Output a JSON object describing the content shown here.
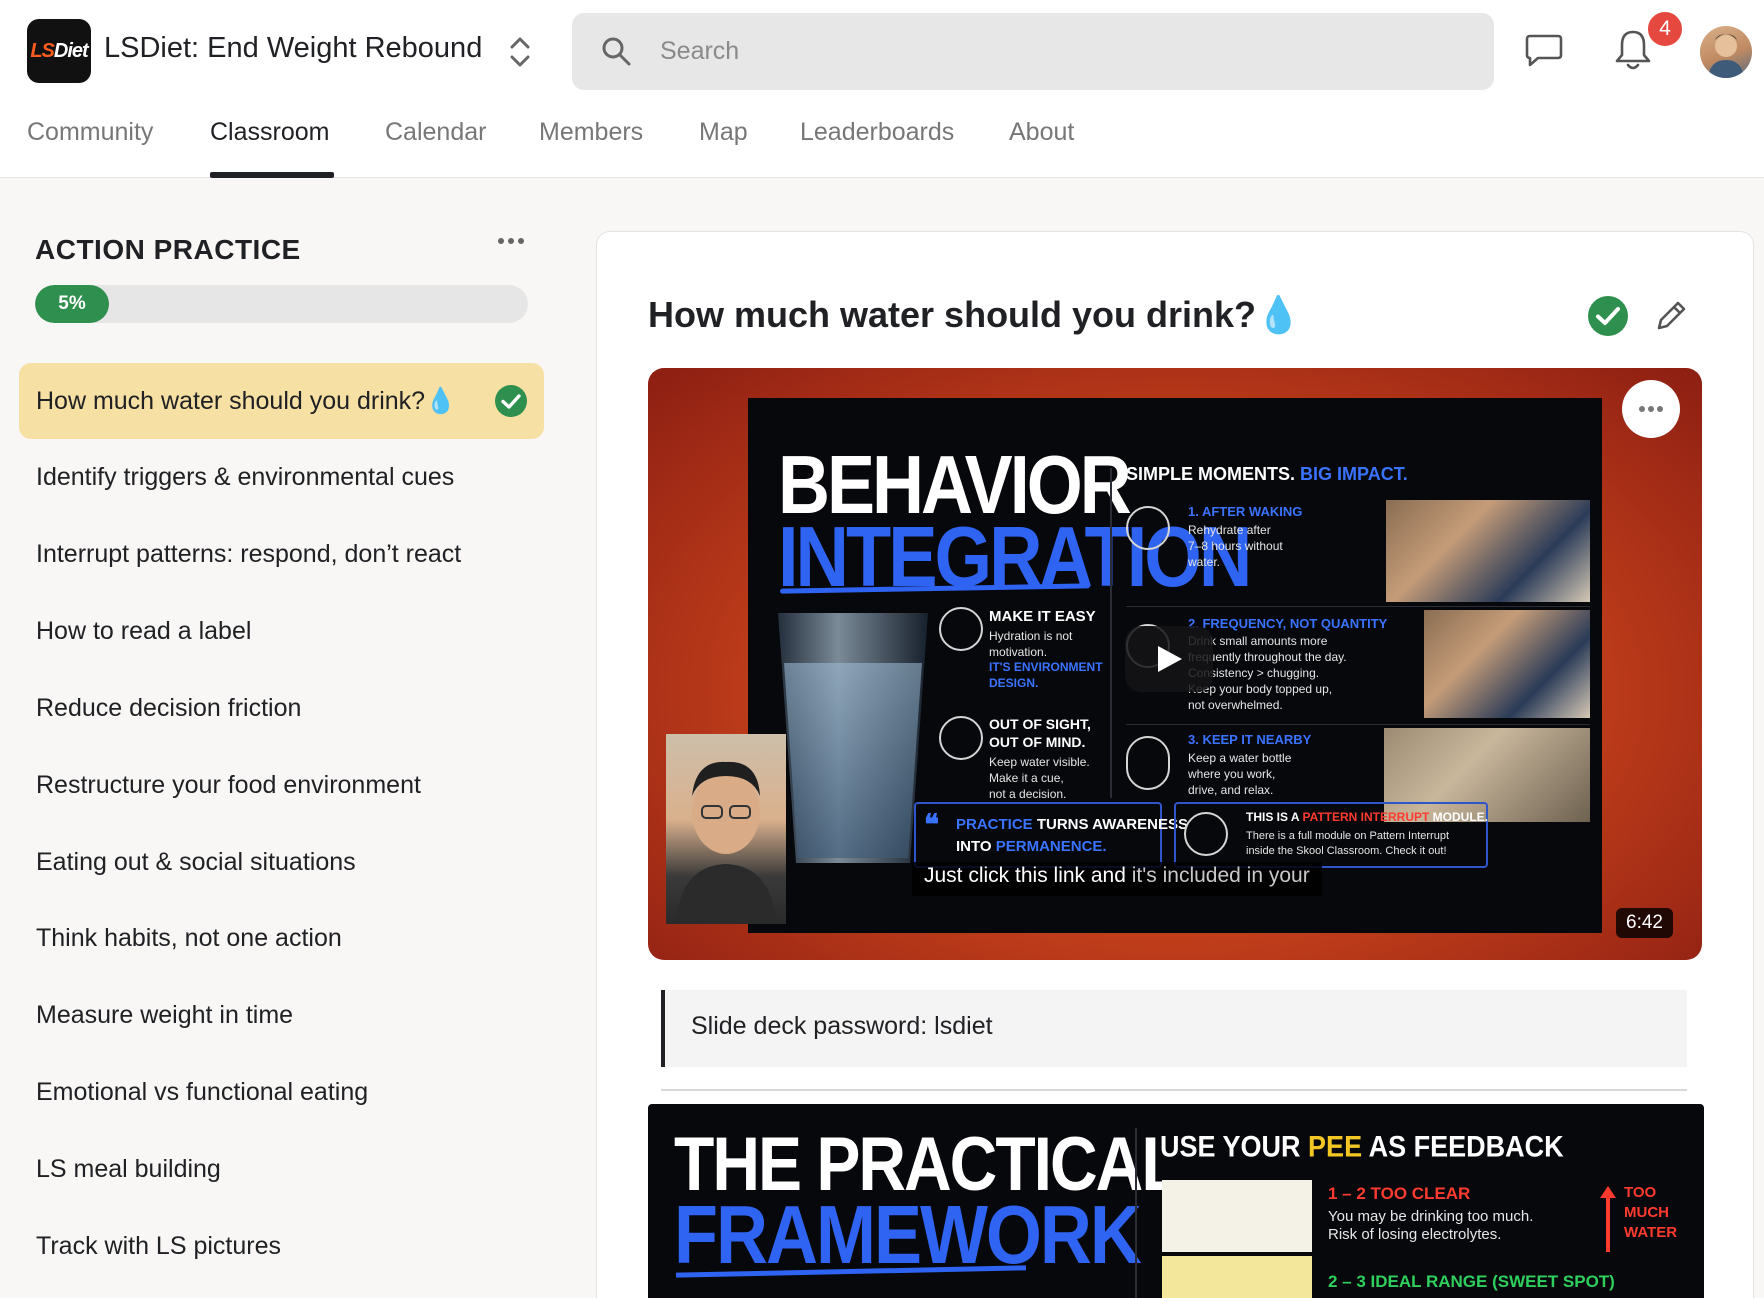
{
  "app": {
    "logo_text_ls": "LS",
    "logo_text_diet": "Diet",
    "title": "LSDiet: End Weight Rebound"
  },
  "search": {
    "placeholder": "Search"
  },
  "notifications": {
    "count": "4"
  },
  "tabs": [
    {
      "label": "Community",
      "active": false
    },
    {
      "label": "Classroom",
      "active": true
    },
    {
      "label": "Calendar",
      "active": false
    },
    {
      "label": "Members",
      "active": false
    },
    {
      "label": "Map",
      "active": false
    },
    {
      "label": "Leaderboards",
      "active": false
    },
    {
      "label": "About",
      "active": false
    }
  ],
  "sidebar": {
    "module_title": "ACTION PRACTICE",
    "progress_label": "5%",
    "progress_value": 5,
    "lessons": [
      {
        "label": "How much water should you drink?💧",
        "active": true,
        "completed": true
      },
      {
        "label": "Identify triggers & environmental cues"
      },
      {
        "label": "Interrupt patterns: respond, don’t react"
      },
      {
        "label": "How to read a label"
      },
      {
        "label": "Reduce decision friction"
      },
      {
        "label": "Restructure your food environment"
      },
      {
        "label": "Eating out & social situations"
      },
      {
        "label": "Think habits, not one action"
      },
      {
        "label": "Measure weight in time"
      },
      {
        "label": "Emotional vs functional eating"
      },
      {
        "label": "LS meal building"
      },
      {
        "label": "Track with LS pictures"
      }
    ]
  },
  "lesson": {
    "title": "How much water should you drink?💧",
    "video": {
      "slide": {
        "headline_1": "BEHAVIOR",
        "headline_2": "INTEGRATION",
        "simple_moments": "SIMPLE MOMENTS.",
        "big_impact": "BIG IMPACT.",
        "make_it_easy": "MAKE IT EASY",
        "make_it_easy_body_1": "Hydration is not",
        "make_it_easy_body_2": "motivation.",
        "make_it_easy_blue_1": "IT'S ENVIRONMENT",
        "make_it_easy_blue_2": "DESIGN.",
        "out_of_sight_1": "OUT OF SIGHT,",
        "out_of_sight_2": "OUT OF MIND.",
        "out_of_sight_body_1": "Keep water visible.",
        "out_of_sight_body_2": "Make it a cue,",
        "out_of_sight_body_3": "not a decision.",
        "item1_title": "1. AFTER WAKING",
        "item1_body_1": "Rehydrate after",
        "item1_body_2": "7–8 hours without",
        "item1_body_3": "water.",
        "item2_title": "2. FREQUENCY, NOT QUANTITY",
        "item2_body_1": "Drink small amounts more",
        "item2_body_2": "frequently throughout the day.",
        "item2_body_3": "Consistency > chugging.",
        "item2_body_4": "Keep your body topped up,",
        "item2_body_5": "not overwhelmed.",
        "item3_title": "3. KEEP IT NEARBY",
        "item3_body_1": "Keep a water bottle",
        "item3_body_2": "where you work,",
        "item3_body_3": "drive, and relax.",
        "quote_mark": "❝",
        "quote_practice": "PRACTICE",
        "quote_turns": " TURNS AWARENESS",
        "quote_into": "INTO ",
        "quote_permanence": "PERMANENCE.",
        "interrupt_this": "THIS IS A ",
        "interrupt_red": "PATTERN INTERRUPT",
        "interrupt_module": " MODULE.",
        "interrupt_body_1": "There is a full module on Pattern Interrupt",
        "interrupt_body_2": "inside the Skool Classroom. Check it out!"
      },
      "caption_bright": "Just click this link and ",
      "caption_dim": "it's included in your",
      "duration": "6:42"
    },
    "password_text": "Slide deck password: lsdiet",
    "slide2": {
      "headline_1": "THE PRACTICAL",
      "headline_2": "FRAMEWORK",
      "pee_use": "USE YOUR ",
      "pee_word": "PEE",
      "pee_rest": " AS FEEDBACK",
      "level1_title": "1 – 2  TOO CLEAR",
      "level1_body_1": "You may be drinking too much.",
      "level1_body_2": "Risk of losing electrolytes.",
      "level1_tag_1": "TOO",
      "level1_tag_2": "MUCH",
      "level1_tag_3": "WATER",
      "level2_title": "2 – 3  IDEAL RANGE (SWEET SPOT)"
    }
  },
  "colors": {
    "active_lesson_bg": "#f7e0a3",
    "progress_green": "#2f8f4e",
    "badge_red": "#e5483e",
    "slide_blue": "#2f63f2"
  }
}
